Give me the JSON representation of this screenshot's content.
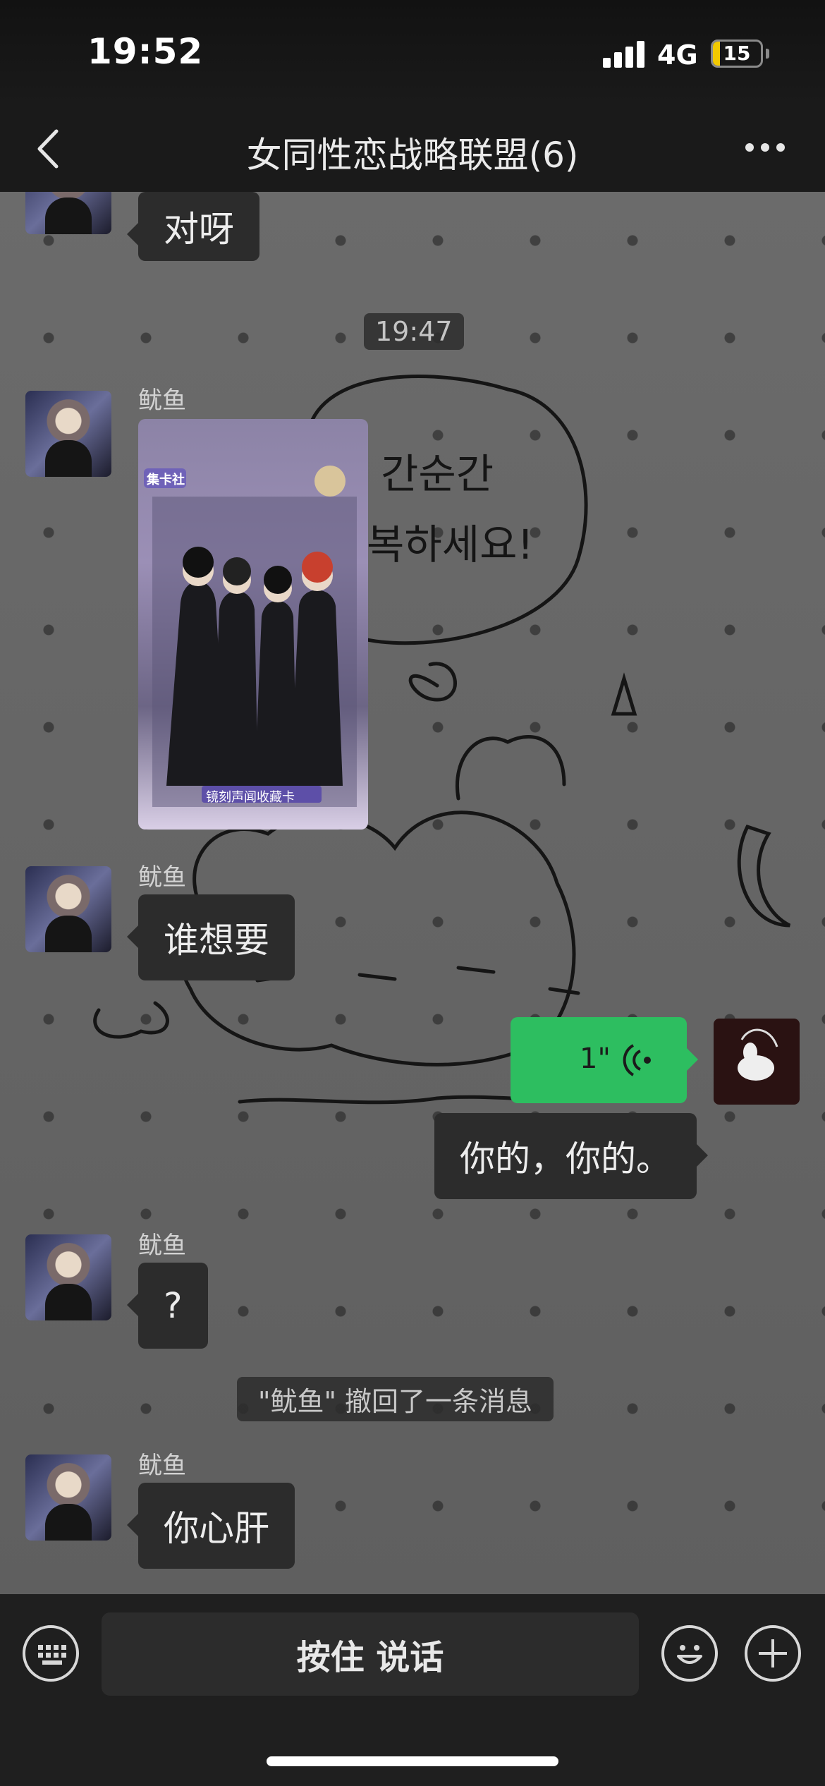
{
  "status_bar": {
    "time": "19:52",
    "network": "4G",
    "battery_text": "15",
    "battery_level": 0.15
  },
  "nav": {
    "title": "女同性恋战略联盟(6)"
  },
  "messages": {
    "top_partial_text": "对呀",
    "timestamp": "19:47",
    "msg1_sender": "鱿鱼",
    "msg2_sender": "鱿鱼",
    "msg2_text": "谁想要",
    "self_voice_duration": "1\"",
    "self_text": "你的，你的。",
    "msg3_sender": "鱿鱼",
    "msg3_text": "?",
    "recall_notice": "\"鱿鱼\" 撤回了一条消息",
    "msg4_sender": "鱿鱼",
    "msg4_text": "你心肝"
  },
  "image_card": {
    "footer_label": "镜刻声闻收藏卡",
    "brand_label": "集卡社"
  },
  "bottom_bar": {
    "hold_to_talk": "按住 说话"
  },
  "icons": {
    "back": "chevron-left-icon",
    "more": "more-dots-icon",
    "keyboard": "keyboard-icon",
    "emoji": "emoji-icon",
    "plus": "plus-icon",
    "voice": "voice-wave-icon"
  },
  "colors": {
    "voice_bubble": "#2dbe60",
    "bubble_bg": "#2c2c2c",
    "chat_bg": "#656565"
  }
}
